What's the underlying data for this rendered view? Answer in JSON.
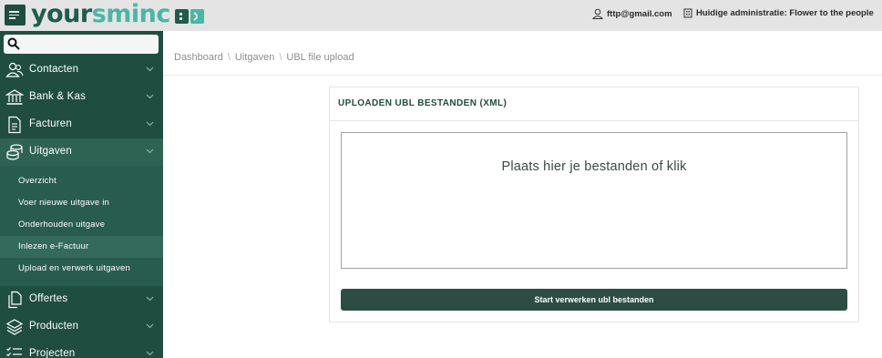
{
  "header": {
    "logo_part1": "your",
    "logo_part2": "sminc",
    "user_email": "fttp@gmail.com",
    "admin_label": "Huidige administratie: Flower to the people"
  },
  "sidebar": {
    "search_placeholder": "",
    "items": [
      {
        "label": "Contacten",
        "icon": "contacts-icon"
      },
      {
        "label": "Bank & Kas",
        "icon": "bank-icon"
      },
      {
        "label": "Facturen",
        "icon": "invoice-icon"
      },
      {
        "label": "Uitgaven",
        "icon": "coins-icon",
        "expanded": true
      },
      {
        "label": "Offertes",
        "icon": "documents-icon"
      },
      {
        "label": "Producten",
        "icon": "layers-icon"
      },
      {
        "label": "Projecten",
        "icon": "checklist-icon"
      }
    ],
    "subitems": [
      {
        "label": "Overzicht"
      },
      {
        "label": "Voer nieuwe uitgave in"
      },
      {
        "label": "Onderhouden uitgave"
      },
      {
        "label": "Inlezen e-Factuur",
        "highlighted": true
      },
      {
        "label": "Upload en verwerk uitgaven"
      }
    ]
  },
  "breadcrumb": {
    "items": [
      "Dashboard",
      "Uitgaven",
      "UBL file upload"
    ],
    "separator": "\\"
  },
  "card": {
    "title": "UPLOADEN UBL BESTANDEN (XML)",
    "dropzone_text": "Plaats hier je bestanden of klik",
    "button_label": "Start verwerken ubl bestanden"
  },
  "colors": {
    "sidebar_bg": "#1f4e41",
    "submenu_bg": "#285c4e",
    "brand_dark": "#1f5c4b",
    "brand_light": "#49b7a5",
    "button_bg": "#2c4d43",
    "topbar_bg": "#e4e4e4"
  }
}
